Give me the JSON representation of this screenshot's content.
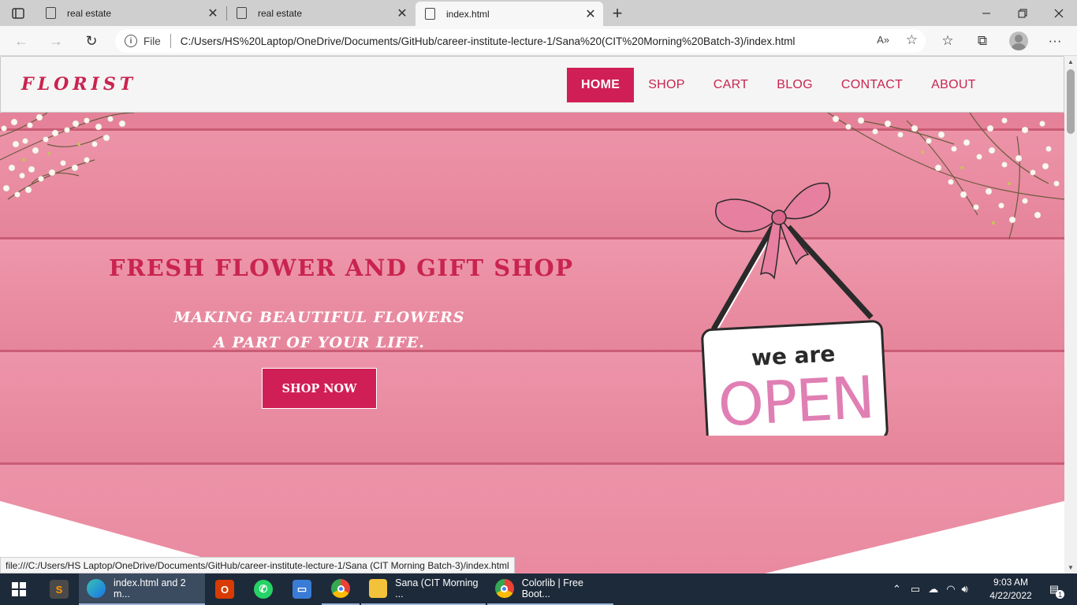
{
  "browser": {
    "tabs": [
      {
        "label": "real estate",
        "icon": "page-icon",
        "active": false
      },
      {
        "label": "real estate",
        "icon": "page-icon",
        "active": false
      },
      {
        "label": "index.html",
        "icon": "page-icon",
        "active": true
      }
    ],
    "url_scheme_label": "File",
    "url": "C:/Users/HS%20Laptop/OneDrive/Documents/GitHub/career-institute-lecture-1/Sana%20(CIT%20Morning%20Batch-3)/index.html",
    "status_url": "file:///C:/Users/HS Laptop/OneDrive/Documents/GitHub/career-institute-lecture-1/Sana (CIT Morning Batch-3)/index.html"
  },
  "site": {
    "logo": "FLORIST",
    "nav": [
      {
        "label": "HOME",
        "active": true
      },
      {
        "label": "SHOP",
        "active": false
      },
      {
        "label": "CART",
        "active": false
      },
      {
        "label": "BLOG",
        "active": false
      },
      {
        "label": "CONTACT",
        "active": false
      },
      {
        "label": "ABOUT",
        "active": false
      }
    ],
    "hero": {
      "title": "FRESH FLOWER AND GIFT SHOP",
      "subtitle_line1": "MAKING BEAUTIFUL FLOWERS",
      "subtitle_line2": "A PART OF YOUR LIFE.",
      "button": "SHOP NOW",
      "sign_top": "we are",
      "sign_bottom": "OPEN"
    },
    "colors": {
      "accent": "#d01f56",
      "hero_bg": "#e98aa0"
    }
  },
  "taskbar": {
    "items": [
      {
        "label": "",
        "icon": "windows-start-icon"
      },
      {
        "label": "",
        "icon": "sublime-text-icon"
      },
      {
        "label": "index.html and 2 m...",
        "icon": "edge-icon"
      },
      {
        "label": "",
        "icon": "office-icon"
      },
      {
        "label": "",
        "icon": "whatsapp-icon"
      },
      {
        "label": "",
        "icon": "computer-icon"
      },
      {
        "label": "",
        "icon": "chrome-icon"
      },
      {
        "label": "Sana (CIT Morning ...",
        "icon": "folder-icon"
      },
      {
        "label": "Colorlib | Free Boot...",
        "icon": "chrome-icon"
      }
    ],
    "time": "9:03 AM",
    "date": "4/22/2022",
    "notification_count": "1"
  }
}
